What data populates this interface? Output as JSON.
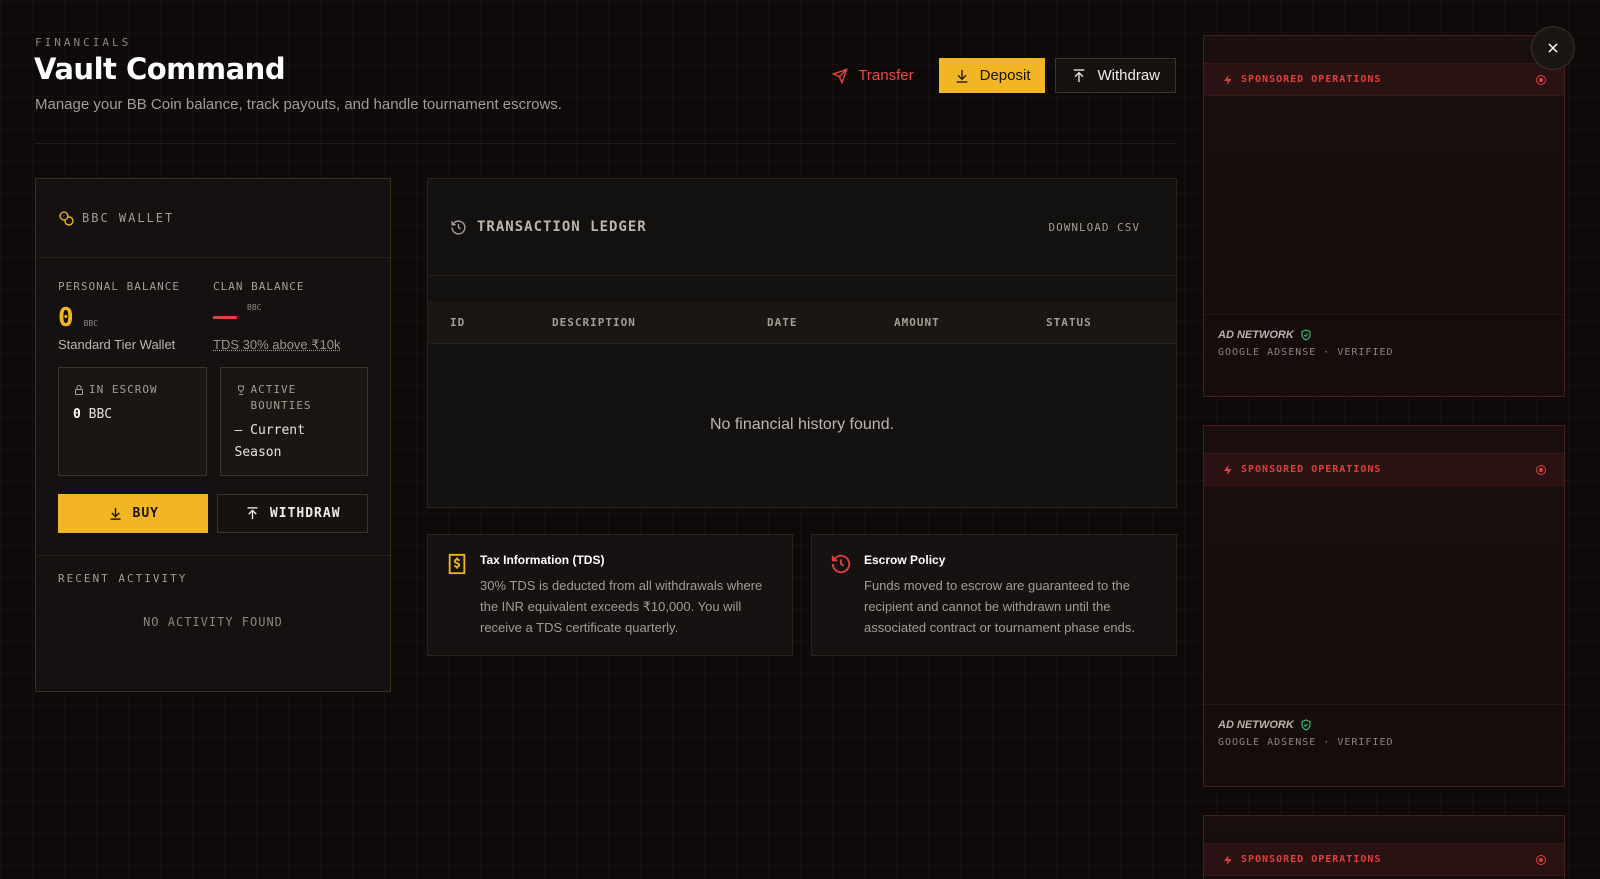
{
  "header": {
    "eyebrow": "FINANCIALS",
    "title": "Vault Command",
    "subtitle": "Manage your BB Coin balance, track payouts, and handle tournament escrows."
  },
  "actions": {
    "transfer": "Transfer",
    "deposit": "Deposit",
    "withdraw": "Withdraw"
  },
  "wallet": {
    "title": "BBC WALLET",
    "personal_label": "PERSONAL BALANCE",
    "personal_value": "0",
    "personal_unit": "BBC",
    "personal_note": "Standard Tier Wallet",
    "clan_label": "CLAN BALANCE",
    "clan_unit": "BBC",
    "clan_note": "TDS 30% above ₹10k",
    "escrow_label": "IN ESCROW",
    "escrow_value": "0",
    "escrow_unit": "BBC",
    "bounties_label": "ACTIVE BOUNTIES",
    "bounties_value": "— Current Season",
    "buy_label": "BUY",
    "withdraw_label": "WITHDRAW",
    "recent_label": "RECENT ACTIVITY",
    "recent_empty": "NO ACTIVITY FOUND"
  },
  "ledger": {
    "title": "TRANSACTION LEDGER",
    "download": "DOWNLOAD CSV",
    "columns": [
      "ID",
      "DESCRIPTION",
      "DATE",
      "AMOUNT",
      "STATUS"
    ],
    "empty": "No financial history found."
  },
  "info": {
    "tax_title": "Tax Information (TDS)",
    "tax_body": "30% TDS is deducted from all withdrawals where the INR equivalent exceeds ₹10,000. You will receive a TDS certificate quarterly.",
    "escrow_title": "Escrow Policy",
    "escrow_body": "Funds moved to escrow are guaranteed to the recipient and cannot be withdrawn until the associated contract or tournament phase ends."
  },
  "ads": [
    {
      "label": "SPONSORED OPERATIONS",
      "network": "AD NETWORK",
      "source": "GOOGLE ADSENSE · VERIFIED"
    },
    {
      "label": "SPONSORED OPERATIONS",
      "network": "AD NETWORK",
      "source": "GOOGLE ADSENSE · VERIFIED"
    },
    {
      "label": "SPONSORED OPERATIONS"
    }
  ],
  "colors": {
    "accent": "#f2b625",
    "danger": "#e0403d",
    "background": "#0d0a09",
    "verified": "#2fb36b"
  }
}
